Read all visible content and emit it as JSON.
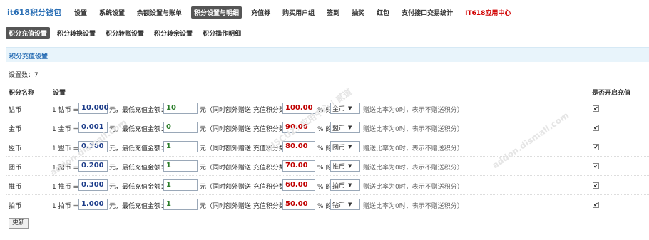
{
  "brand": "it618积分钱包",
  "topnav": [
    "设置",
    "系统设置",
    "余额设置与账单",
    "积分设置与明细",
    "充值券",
    "购买用户组",
    "签到",
    "抽奖",
    "红包",
    "支付接口交易统计",
    "IT618应用中心"
  ],
  "subnav": [
    "积分充值设置",
    "积分转换设置",
    "积分转账设置",
    "积分转余设置",
    "积分操作明细"
  ],
  "section_title": "积分充值设置",
  "count_label": "设置数：7",
  "headers": {
    "name": "积分名称",
    "setting": "设置",
    "enable": "是否开启充值"
  },
  "text": {
    "one": "1",
    "eq": "=",
    "yuan_min": "元，最低充值金额：",
    "yuan_gift": "元（同时额外赠送 充值积分数*",
    "pct_of": "% 的",
    "note": "赠送比率为0时，表示不赠送积分）"
  },
  "rows": [
    {
      "name": "钻币",
      "rate": "10.000",
      "min": "10",
      "pct": "100.00",
      "gift": "金币",
      "checked": "✔"
    },
    {
      "name": "金币",
      "rate": "0.001",
      "min": "0",
      "pct": "90.00",
      "gift": "盟币",
      "checked": "✔"
    },
    {
      "name": "盟币",
      "rate": "0.100",
      "min": "1",
      "pct": "80.00",
      "gift": "团币",
      "checked": "✔"
    },
    {
      "name": "团币",
      "rate": "0.200",
      "min": "1",
      "pct": "70.00",
      "gift": "推币",
      "checked": "✔"
    },
    {
      "name": "推币",
      "rate": "0.300",
      "min": "1",
      "pct": "60.00",
      "gift": "拍币",
      "checked": "✔"
    },
    {
      "name": "拍币",
      "rate": "1.000",
      "min": "1",
      "pct": "50.00",
      "gift": "钻币",
      "checked": "✔"
    }
  ],
  "update_button": "更新",
  "watermark": [
    "DISCUZ! 应用中心 | 贰道",
    "addon.dismall.com"
  ]
}
